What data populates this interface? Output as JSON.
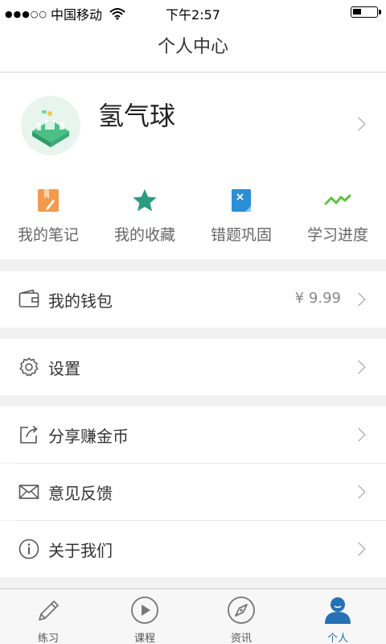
{
  "status_bar": {
    "carrier": "中国移动",
    "time": "下午2:57",
    "battery_level": 0.35
  },
  "navbar": {
    "title": "个人中心"
  },
  "profile": {
    "username": "氢气球"
  },
  "shortcuts": [
    {
      "label": "我的笔记",
      "icon": "note-icon",
      "color": "#f39a4e"
    },
    {
      "label": "我的收藏",
      "icon": "star-icon",
      "color": "#2a9d80"
    },
    {
      "label": "错题巩固",
      "icon": "wrong-question-icon",
      "color": "#2b8fd6"
    },
    {
      "label": "学习进度",
      "icon": "progress-icon",
      "color": "#5cc23c"
    }
  ],
  "menu": {
    "wallet": {
      "label": "我的钱包",
      "value": "¥ 9.99"
    },
    "settings": {
      "label": "设置"
    },
    "share": {
      "label": "分享赚金币"
    },
    "feedback": {
      "label": "意见反馈"
    },
    "about": {
      "label": "关于我们"
    }
  },
  "tabbar": [
    {
      "label": "练习",
      "icon": "pencil-icon",
      "active": false
    },
    {
      "label": "课程",
      "icon": "play-icon",
      "active": false
    },
    {
      "label": "资讯",
      "icon": "compass-icon",
      "active": false
    },
    {
      "label": "个人",
      "icon": "person-icon",
      "active": true
    }
  ],
  "colors": {
    "accent": "#2471b5",
    "background": "#f1f1f1"
  }
}
